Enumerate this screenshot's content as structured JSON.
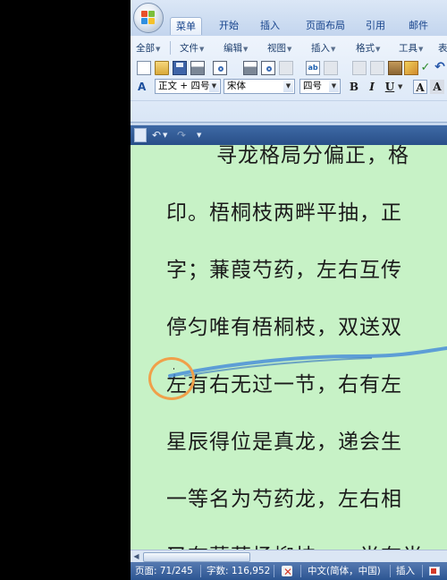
{
  "tabs": [
    {
      "label": "菜单",
      "active": true
    },
    {
      "label": "开始",
      "active": false
    },
    {
      "label": "插入",
      "active": false
    },
    {
      "label": "页面布局",
      "active": false
    },
    {
      "label": "引用",
      "active": false
    },
    {
      "label": "邮件",
      "active": false
    }
  ],
  "menu": [
    "全部",
    "文件",
    "编辑",
    "视图",
    "插入",
    "格式",
    "工具",
    "表"
  ],
  "format_bar": {
    "style_value": "正文 + 四号",
    "font_value": "宋体",
    "size_value": "四号",
    "buttons": [
      "B",
      "I",
      "U",
      "A",
      "A"
    ]
  },
  "document": {
    "lines": [
      "寻龙格局分偏正，格",
      "印。梧桐枝两畔平抽，正",
      "字；蒹葭芍药，左右互传",
      "停匀唯有梧桐枝，双送双",
      "左有右无过一节，右有左",
      "星辰得位是真龙，递会生",
      "一等名为芍药龙，左右相",
      "又有蒹葭杨柳枝，一半有半"
    ]
  },
  "status": {
    "page": "页面: 71/245",
    "words": "字数: 116,952",
    "language": "中文(简体，中国)",
    "mode": "插入"
  },
  "colors": {
    "doc_background": "#c7f2c6",
    "statusbar": "#2c5592",
    "ink_stroke": "#4a8fd8",
    "cursor_circle": "#f0a04a"
  }
}
